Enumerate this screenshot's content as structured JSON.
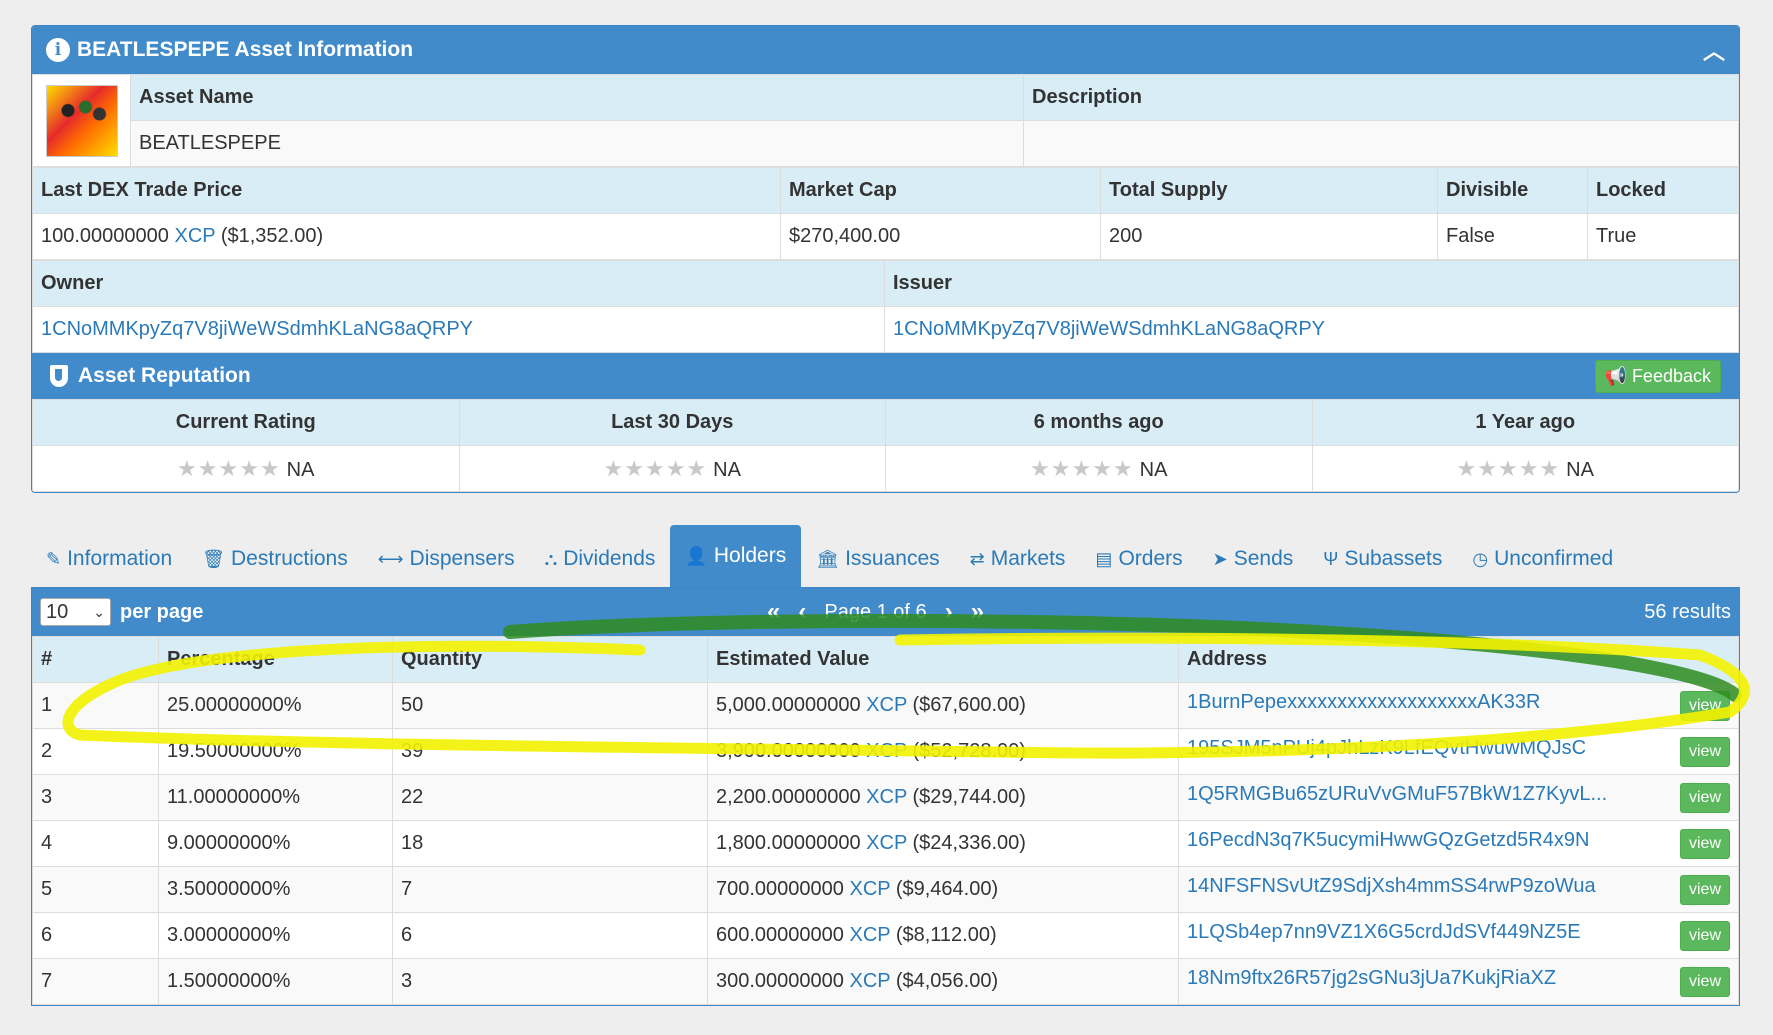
{
  "asset_panel": {
    "title": "BEATLESPEPE Asset Information",
    "asset_name_label": "Asset Name",
    "asset_name": "BEATLESPEPE",
    "description_label": "Description",
    "description": "",
    "dex_price_label": "Last DEX Trade Price",
    "dex_price_value": "100.00000000",
    "dex_price_unit": "XCP",
    "dex_price_usd": "($1,352.00)",
    "market_cap_label": "Market Cap",
    "market_cap": "$270,400.00",
    "total_supply_label": "Total Supply",
    "total_supply": "200",
    "divisible_label": "Divisible",
    "divisible": "False",
    "locked_label": "Locked",
    "locked": "True",
    "owner_label": "Owner",
    "owner": "1CNoMMKpyZq7V8jiWeWSdmhKLaNG8aQRPY",
    "issuer_label": "Issuer",
    "issuer": "1CNoMMKpyZq7V8jiWeWSdmhKLaNG8aQRPY"
  },
  "reputation": {
    "title": "Asset Reputation",
    "feedback_label": "Feedback",
    "columns": [
      "Current Rating",
      "Last 30 Days",
      "6 months ago",
      "1 Year ago"
    ],
    "values": [
      "NA",
      "NA",
      "NA",
      "NA"
    ],
    "stars": "★★★★★"
  },
  "tabs": [
    {
      "label": "Information",
      "icon": "✎"
    },
    {
      "label": "Destructions",
      "icon": "🗑"
    },
    {
      "label": "Dispensers",
      "icon": "⟷"
    },
    {
      "label": "Dividends",
      "icon": "⛬"
    },
    {
      "label": "Holders",
      "icon": "👤"
    },
    {
      "label": "Issuances",
      "icon": "🏛"
    },
    {
      "label": "Markets",
      "icon": "⇄"
    },
    {
      "label": "Orders",
      "icon": "▤"
    },
    {
      "label": "Sends",
      "icon": "➤"
    },
    {
      "label": "Subassets",
      "icon": "Ψ"
    },
    {
      "label": "Unconfirmed",
      "icon": "◷"
    }
  ],
  "active_tab": "Holders",
  "holders": {
    "per_page_value": "10",
    "per_page_label": "per page",
    "page_text": "Page 1 of 6",
    "results_text": "56 results",
    "columns": [
      "#",
      "Percentage",
      "Quantity",
      "Estimated Value",
      "Address"
    ],
    "view_label": "view",
    "rows": [
      {
        "n": "1",
        "pct": "25.00000000%",
        "qty": "50",
        "value": "5,000.00000000",
        "unit": "XCP",
        "usd": "($67,600.00)",
        "address": "1BurnPepexxxxxxxxxxxxxxxxxxxAK33R"
      },
      {
        "n": "2",
        "pct": "19.50000000%",
        "qty": "39",
        "value": "3,900.00000000",
        "unit": "XCP",
        "usd": "($52,728.00)",
        "address": "195SJM5nPUj4pJhLzK9LfEQvtHwuwMQJsC"
      },
      {
        "n": "3",
        "pct": "11.00000000%",
        "qty": "22",
        "value": "2,200.00000000",
        "unit": "XCP",
        "usd": "($29,744.00)",
        "address": "1Q5RMGBu65zURuVvGMuF57BkW1Z7KyvL..."
      },
      {
        "n": "4",
        "pct": "9.00000000%",
        "qty": "18",
        "value": "1,800.00000000",
        "unit": "XCP",
        "usd": "($24,336.00)",
        "address": "16PecdN3q7K5ucymiHwwGQzGetzd5R4x9N"
      },
      {
        "n": "5",
        "pct": "3.50000000%",
        "qty": "7",
        "value": "700.00000000",
        "unit": "XCP",
        "usd": "($9,464.00)",
        "address": "14NFSFNSvUtZ9SdjXsh4mmSS4rwP9zoWua"
      },
      {
        "n": "6",
        "pct": "3.00000000%",
        "qty": "6",
        "value": "600.00000000",
        "unit": "XCP",
        "usd": "($8,112.00)",
        "address": "1LQSb4ep7nn9VZ1X6G5crdJdSVf449NZ5E"
      },
      {
        "n": "7",
        "pct": "1.50000000%",
        "qty": "3",
        "value": "300.00000000",
        "unit": "XCP",
        "usd": "($4,056.00)",
        "address": "18Nm9ftx26R57jg2sGNu3jUa7KukjRiaXZ"
      }
    ]
  },
  "colors": {
    "primary": "#428bca",
    "header_cell": "#d9edf7",
    "link": "#2a7ab8",
    "success": "#5cb85c",
    "highlight_yellow": "#f2f200",
    "highlight_green": "#2e8b1f"
  }
}
